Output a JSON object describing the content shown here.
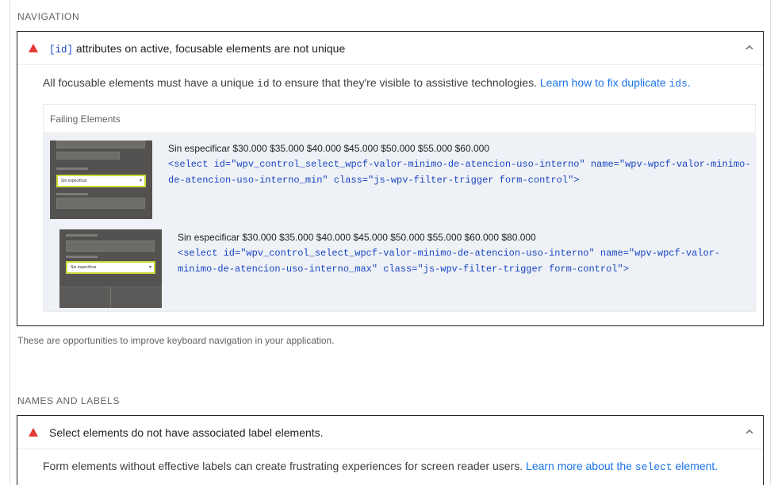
{
  "navigation": {
    "group_title": "NAVIGATION",
    "audit": {
      "title_code": "[id]",
      "title_rest": " attributes on active, focusable elements are not unique",
      "description_pre": "All focusable elements must have a unique ",
      "description_code": "id",
      "description_mid": " to ensure that they're visible to assistive technologies. ",
      "link_text": "Learn how to fix duplicate ",
      "link_code": "ids",
      "link_suffix": ".",
      "table_header": "Failing Elements",
      "rows": [
        {
          "label": "Sin especificar $30.000 $35.000 $40.000 $45.000 $50.000 $55.000 $60.000",
          "snippet": "<select id=\"wpv_control_select_wpcf-valor-minimo-de-atencion-uso-interno\" name=\"wpv-wpcf-valor-minimo-de-atencion-uso-interno_min\" class=\"js-wpv-filter-trigger form-control\">",
          "thumb_select_text": "Sin especificar",
          "thumb_label_text": "Valor máximo",
          "thumb_other_text": "Sin especificar"
        },
        {
          "label": "Sin especificar $30.000 $35.000 $40.000 $45.000 $50.000 $55.000 $60.000 $80.000",
          "snippet": "<select id=\"wpv_control_select_wpcf-valor-minimo-de-atencion-uso-interno\" name=\"wpv-wpcf-valor-minimo-de-atencion-uso-interno_max\" class=\"js-wpv-filter-trigger form-control\">",
          "thumb_select_text": "Sin especificar",
          "thumb_label_text": "Valor mínimo",
          "thumb_other_text": "Sin especificar"
        }
      ]
    },
    "footer": "These are opportunities to improve keyboard navigation in your application."
  },
  "names_labels": {
    "group_title": "NAMES AND LABELS",
    "audit": {
      "title": "Select elements do not have associated label elements.",
      "description_pre": "Form elements without effective labels can create frustrating experiences for screen reader users. ",
      "link_text": "Learn more about the ",
      "link_code": "select",
      "link_suffix": " element."
    }
  },
  "colors": {
    "fail": "#e53935",
    "link": "#1a73e8",
    "code": "#1a46c4",
    "highlight": "#cddc39"
  },
  "icons": {
    "fail": "warning-triangle-icon",
    "collapse": "chevron-up-icon"
  }
}
